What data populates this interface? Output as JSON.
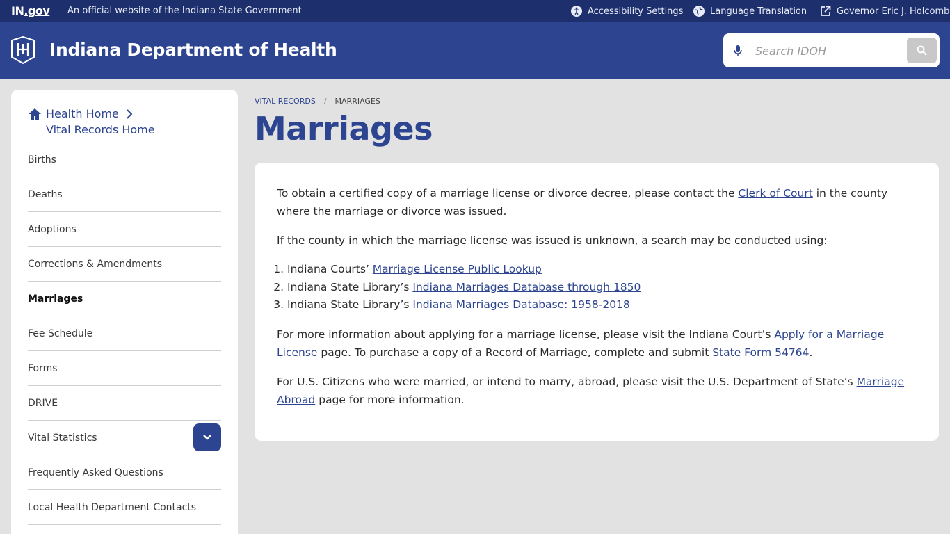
{
  "topbar": {
    "logo_main": "IN",
    "logo_tld": ".gov",
    "official_text": "An official website of the Indiana State Government",
    "accessibility": "Accessibility Settings",
    "language": "Language Translation",
    "governor": "Governor Eric J. Holcomb"
  },
  "header": {
    "site_title": "Indiana Department of Health",
    "search_placeholder": "Search IDOH"
  },
  "sidebar": {
    "health_home": "Health Home",
    "vital_records_home": "Vital Records Home",
    "items": [
      {
        "label": "Births"
      },
      {
        "label": "Deaths"
      },
      {
        "label": "Adoptions"
      },
      {
        "label": "Corrections & Amendments"
      },
      {
        "label": "Marriages"
      },
      {
        "label": "Fee Schedule"
      },
      {
        "label": "Forms"
      },
      {
        "label": "DRIVE"
      },
      {
        "label": "Vital Statistics"
      },
      {
        "label": "Frequently Asked Questions"
      },
      {
        "label": "Local Health Department Contacts"
      }
    ]
  },
  "breadcrumb": {
    "parent": "Vital Records",
    "separator": "/",
    "current": "Marriages"
  },
  "main": {
    "title": "Marriages",
    "p1_a": "To obtain a certified copy of a marriage license or divorce decree, please contact the ",
    "p1_link": "Clerk of Court",
    "p1_b": " in the county where the marriage or divorce was issued.",
    "p2": "If the county in which the marriage license was issued is unknown, a search may be conducted using:",
    "list": [
      {
        "prefix": "Indiana Courts’ ",
        "link": "Marriage License Public Lookup"
      },
      {
        "prefix": "Indiana State Library’s ",
        "link": "Indiana Marriages Database through 1850"
      },
      {
        "prefix": "Indiana State Library’s ",
        "link": "Indiana Marriages Database: 1958-2018"
      }
    ],
    "p3_a": "For more information about applying for a marriage license, please visit the Indiana Court’s ",
    "p3_link1": "Apply for a Marriage License",
    "p3_b": " page. To purchase a copy of a Record of Marriage, complete and submit ",
    "p3_link2": "State Form 54764",
    "p3_c": ".",
    "p4_a": "For U.S. Citizens who were married, or intend to marry, abroad, please visit the U.S. Department of State’s ",
    "p4_link": "Marriage Abroad",
    "p4_b": " page for more information."
  },
  "colors": {
    "topbar": "#1d2f6d",
    "header": "#2d4591",
    "background": "#e2e2e2",
    "accent": "#2d4591"
  },
  "icons": {
    "accessibility": "accessibility-icon",
    "language": "globe-icon",
    "governor": "external-link-icon",
    "search_mic": "microphone-icon",
    "search_go": "search-icon",
    "home": "home-icon",
    "expand": "chevron-down-icon"
  }
}
